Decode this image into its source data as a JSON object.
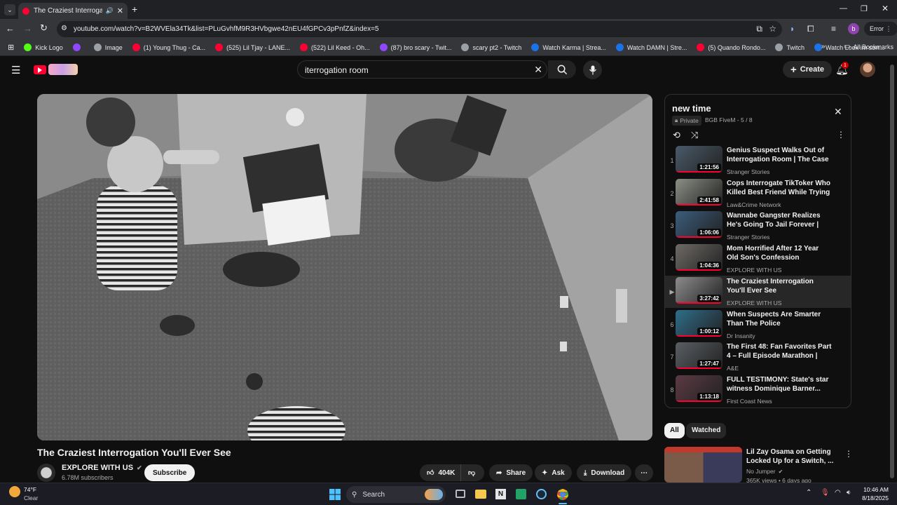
{
  "browser": {
    "tab_title": "The Craziest Interrogation Y",
    "new_tab": "+",
    "url": "youtube.com/watch?v=B2WVEla34Tk&list=PLuGvhfM9R3HVbgwe42nEU4fGPCv3pPnfZ&index=5",
    "profile_initial": "b",
    "error_label": "Error",
    "bookmarks": [
      {
        "label": "Kick Logo",
        "color": "#53fc18"
      },
      {
        "label": "",
        "color": "#9146ff"
      },
      {
        "label": "Image",
        "color": "#9aa0a6"
      },
      {
        "label": "(1) Young Thug - Ca...",
        "color": "#ff0033"
      },
      {
        "label": "(525) Lil Tjay - LANE...",
        "color": "#ff0033"
      },
      {
        "label": "(522) Lil Keed - Oh...",
        "color": "#ff0033"
      },
      {
        "label": "(87) bro scary - Twit...",
        "color": "#9146ff"
      },
      {
        "label": "scary pt2 - Twitch",
        "color": "#9aa0a6"
      },
      {
        "label": "Watch Karma | Strea...",
        "color": "#1a73e8"
      },
      {
        "label": "Watch DAMN | Stre...",
        "color": "#1a73e8"
      },
      {
        "label": "(5) Quando Rondo...",
        "color": "#ff0033"
      },
      {
        "label": "Twitch",
        "color": "#9aa0a6"
      },
      {
        "label": "Watch Look im sorr...",
        "color": "#1a73e8"
      }
    ],
    "all_bookmarks": "All Bookmarks"
  },
  "youtube": {
    "search_value": "iterrogation room",
    "create_label": "Create",
    "notif_count": "1",
    "video_title": "The Craziest Interrogation You'll Ever See",
    "channel_name": "EXPLORE WITH US",
    "subscribers": "6.78M subscribers",
    "subscribe": "Subscribe",
    "likes": "404K",
    "share": "Share",
    "ask": "Ask",
    "download": "Download",
    "playlist": {
      "title": "new time",
      "privacy": "Private",
      "owner_progress": "BGB FiveM - 5 / 8",
      "items": [
        {
          "num": "1",
          "title": "Genius Suspect Walks Out of Interrogation Room | The Case o...",
          "channel": "Stranger Stories",
          "duration": "1:21:56",
          "thumb": "#4a5a6a"
        },
        {
          "num": "2",
          "title": "Cops Interrogate TikToker Who Killed Best Friend While Trying t...",
          "channel": "Law&Crime Network",
          "duration": "2:41:58",
          "thumb": "#8a8f86"
        },
        {
          "num": "3",
          "title": "Wannabe Gangster Realizes He's Going To Jail Forever | The...",
          "channel": "Stranger Stories",
          "duration": "1:06:06",
          "thumb": "#3b5d7c"
        },
        {
          "num": "4",
          "title": "Mom Horrified After 12 Year Old Son's Confession",
          "channel": "EXPLORE WITH US",
          "duration": "1:04:36",
          "thumb": "#6e6a66"
        },
        {
          "num": "▶",
          "title": "The Craziest Interrogation You'll Ever See",
          "channel": "EXPLORE WITH US",
          "duration": "3:27:42",
          "thumb": "#8c8c8c"
        },
        {
          "num": "6",
          "title": "When Suspects Are Smarter Than The Police",
          "channel": "Dr Insanity",
          "duration": "1:00:12",
          "thumb": "#2f6e8a"
        },
        {
          "num": "7",
          "title": "The First 48: Fan Favorites Part 4 – Full Episode Marathon | A&E",
          "channel": "A&E",
          "duration": "1:27:47",
          "thumb": "#5a5f64"
        },
        {
          "num": "8",
          "title": "FULL TESTIMONY: State's star witness Dominique Barner...",
          "channel": "First Coast News",
          "duration": "1:13:18",
          "thumb": "#5c3a44"
        }
      ]
    },
    "chips": [
      "All",
      "Watched"
    ],
    "recommended": {
      "title": "Lil Zay Osama on Getting Locked Up for a Switch, ...",
      "channel": "No Jumper",
      "meta": "365K views • 6 days ago"
    }
  },
  "taskbar": {
    "temp": "74°F",
    "weather": "Clear",
    "search": "Search",
    "time": "10:46 AM",
    "date": "8/18/2025"
  }
}
